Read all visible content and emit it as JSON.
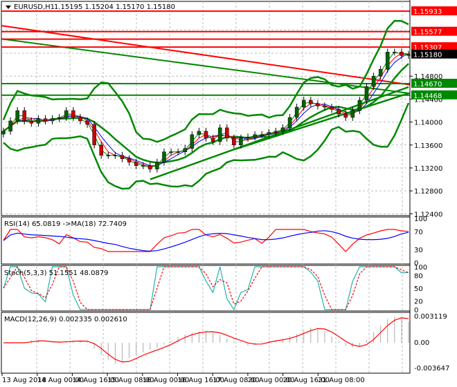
{
  "header": {
    "symbol": "EURUSD,H1",
    "ohlc": "1.15195 1.15204 1.15170 1.15180"
  },
  "colors": {
    "up": "#006400",
    "down": "#cc0000",
    "band": "#008000",
    "level_red": "#ff0000",
    "level_green": "#008000",
    "ma_blue": "#0000ff"
  },
  "chart_data": {
    "type": "line",
    "title": "EURUSD,H1",
    "price_axis": {
      "min": 1.124,
      "max": 1.16,
      "ticks": [
        "1.12400",
        "1.12800",
        "1.13200",
        "1.13600",
        "1.14000",
        "1.14400",
        "1.14800"
      ]
    },
    "levels": [
      {
        "value": 1.15933,
        "label": "1.15933",
        "color": "red"
      },
      {
        "value": 1.15577,
        "label": "1.15577",
        "color": "red"
      },
      {
        "value": 1.15445,
        "label": "",
        "color": "red"
      },
      {
        "value": 1.15307,
        "label": "1.15307",
        "color": "red"
      },
      {
        "value": 1.1518,
        "label": "1.15180",
        "color": "black"
      },
      {
        "value": 1.1467,
        "label": "1.14670",
        "color": "green"
      },
      {
        "value": 1.14468,
        "label": "1.14468",
        "color": "green"
      }
    ],
    "long_ma": [
      {
        "from": 1.1568,
        "to": 1.1465,
        "color": "red"
      },
      {
        "from": 1.1545,
        "to": 1.145,
        "color": "green"
      }
    ],
    "trendlines": [
      {
        "from_idx": 21,
        "from": 1.13,
        "to_idx": 58,
        "to": 1.1461
      },
      {
        "from_idx": 33,
        "from": 1.1352,
        "to_idx": 58,
        "to": 1.145
      }
    ],
    "closes": [
      1.1384,
      1.1402,
      1.142,
      1.1402,
      1.1398,
      1.1406,
      1.1402,
      1.1406,
      1.1408,
      1.142,
      1.1408,
      1.1402,
      1.1396,
      1.136,
      1.1342,
      1.1342,
      1.1342,
      1.1336,
      1.133,
      1.1324,
      1.1324,
      1.1318,
      1.133,
      1.1348,
      1.1348,
      1.1348,
      1.1354,
      1.1378,
      1.1384,
      1.1372,
      1.1366,
      1.139,
      1.1372,
      1.136,
      1.1372,
      1.1374,
      1.1378,
      1.1378,
      1.1382,
      1.1384,
      1.139,
      1.1408,
      1.1426,
      1.1438,
      1.1432,
      1.1428,
      1.1426,
      1.1422,
      1.1414,
      1.1408,
      1.142,
      1.1438,
      1.1462,
      1.148,
      1.1492,
      1.1522,
      1.1522,
      1.1516,
      1.1518
    ],
    "time_labels": [
      "13 Aug 2018",
      "14 Aug 00:00",
      "14 Aug 16:00",
      "15 Aug 08:00",
      "16 Aug 00:00",
      "16 Aug 16:00",
      "17 Aug 08:00",
      "20 Aug 00:00",
      "20 Aug 16:00",
      "21 Aug 08:00"
    ],
    "rsi": {
      "label": "RSI(14) 65.0819  ->MA(18) 72.7409",
      "ticks": [
        "100",
        "70",
        "30",
        "0"
      ]
    },
    "stoch": {
      "label": "Stoch(5,3,3) 51.1551 48.0879",
      "ticks": [
        "100",
        "80",
        "50",
        "20",
        "0"
      ]
    },
    "macd": {
      "label": "MACD(12,26,9) 0.002335 0.002610",
      "ticks": [
        "0.003119",
        "0.00",
        "-0.003647"
      ]
    }
  }
}
